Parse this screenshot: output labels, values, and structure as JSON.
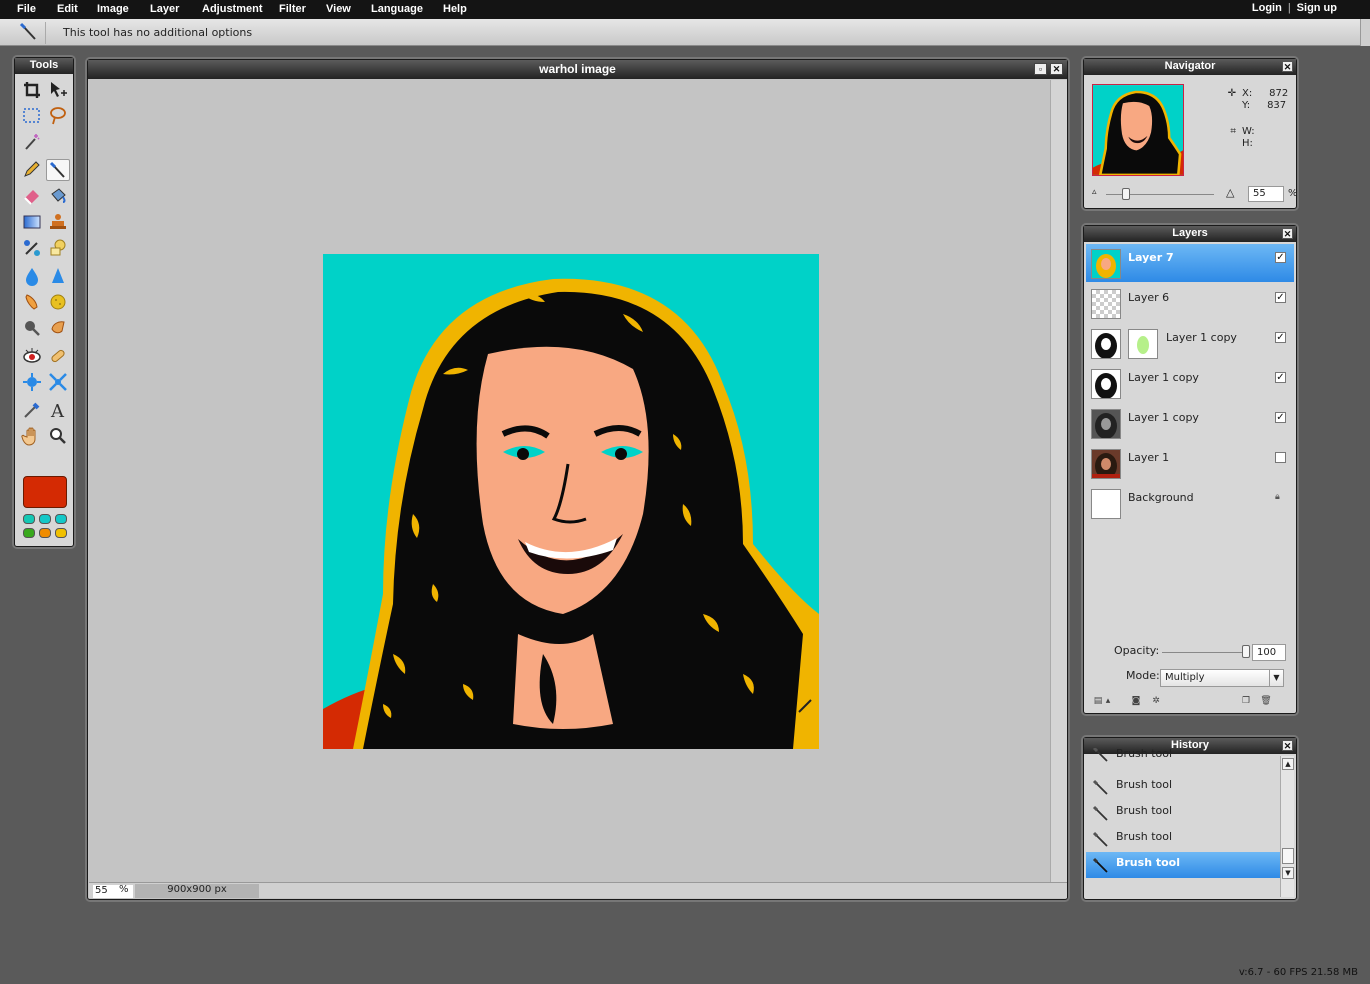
{
  "menubar": {
    "items": [
      "File",
      "Edit",
      "Image",
      "Layer",
      "Adjustment",
      "Filter",
      "View",
      "Language",
      "Help"
    ],
    "login": "Login",
    "separator": "|",
    "signup": "Sign up"
  },
  "options_bar": {
    "active_tool_icon": "brush-icon",
    "message": "This tool has no additional options"
  },
  "tools_panel": {
    "title": "Tools",
    "tools": [
      "crop-icon",
      "move-icon",
      "marquee-icon",
      "lasso-icon",
      "magic-wand-icon",
      "pencil-icon",
      "brush-icon",
      "eraser-icon",
      "bucket-icon",
      "gradient-icon",
      "clone-stamp-icon",
      "color-replace-icon",
      "shape-icon",
      "blur-icon",
      "sharpen-icon",
      "smudge-icon",
      "sponge-icon",
      "dodge-icon",
      "burn-icon",
      "red-eye-icon",
      "spot-heal-icon",
      "bloat-icon",
      "pinch-icon",
      "color-picker-icon",
      "type-icon",
      "hand-icon",
      "zoom-icon"
    ],
    "active_tool": "brush-icon",
    "foreground_color": "#d42a03",
    "preset_colors": [
      "#14c8b4",
      "#14c8c8",
      "#14c8c8",
      "#38a81c",
      "#f08c00",
      "#f0c000"
    ]
  },
  "document": {
    "title": "warhol image",
    "zoom": "55",
    "zoom_unit": "%",
    "size": "900x900 px"
  },
  "navigator": {
    "title": "Navigator",
    "x_label": "X:",
    "x_value": "872",
    "y_label": "Y:",
    "y_value": "837",
    "w_label": "W:",
    "h_label": "H:",
    "zoom": "55",
    "zoom_unit": "%"
  },
  "layers": {
    "title": "Layers",
    "items": [
      {
        "name": "Layer 7",
        "visible": true,
        "selected": true
      },
      {
        "name": "Layer 6",
        "visible": true,
        "selected": false
      },
      {
        "name": "Layer 1 copy",
        "visible": true,
        "selected": false,
        "has_mask": true
      },
      {
        "name": "Layer 1 copy",
        "visible": true,
        "selected": false
      },
      {
        "name": "Layer 1 copy",
        "visible": true,
        "selected": false
      },
      {
        "name": "Layer 1",
        "visible": false,
        "selected": false
      },
      {
        "name": "Background",
        "visible": true,
        "locked": true,
        "selected": false
      }
    ],
    "opacity_label": "Opacity:",
    "opacity": "100",
    "mode_label": "Mode:",
    "mode": "Multiply"
  },
  "history": {
    "title": "History",
    "items": [
      "Brush tool",
      "Brush tool",
      "Brush tool",
      "Brush tool",
      "Brush tool"
    ],
    "selected_index": 4
  },
  "footer": {
    "version": "v:6.7 - 60 FPS 21.58 MB"
  },
  "colors": {
    "canvas_bg": "#00d2c8",
    "hair_highlight": "#f0b400",
    "skin": "#f8a882",
    "shirt": "#d42a03",
    "selection": "#2e8ae6"
  }
}
